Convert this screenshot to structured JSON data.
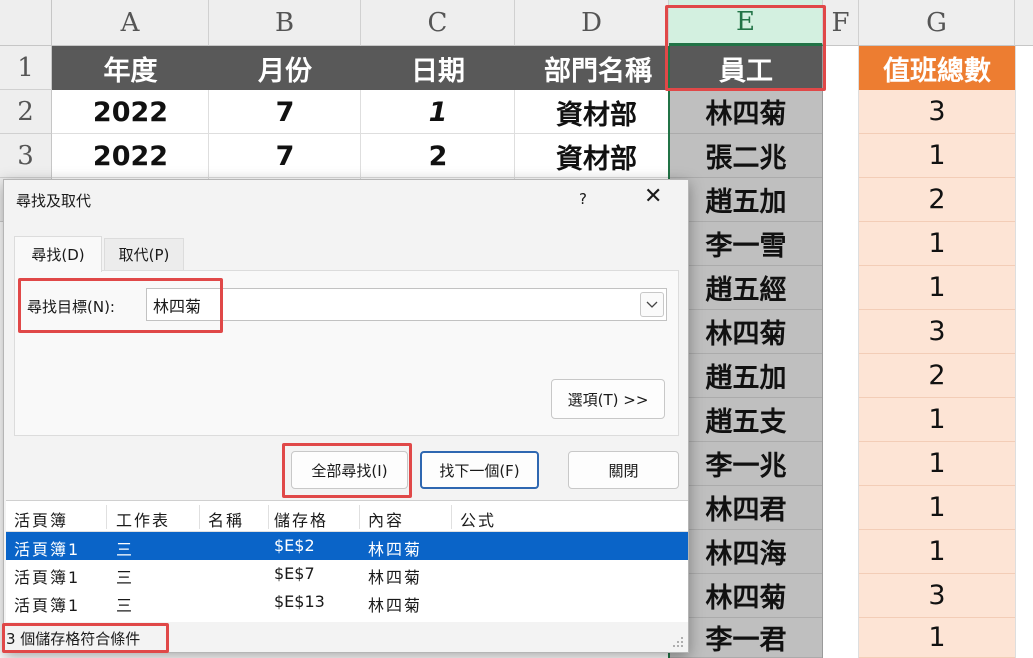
{
  "spreadsheet": {
    "column_headers": [
      "A",
      "B",
      "C",
      "D",
      "E",
      "F",
      "G"
    ],
    "row_headers": [
      "1",
      "2",
      "3"
    ],
    "header_row": {
      "year": "年度",
      "month": "月份",
      "day": "日期",
      "dept": "部門名稱",
      "employee": "員工",
      "duty_total": "值班總數"
    },
    "rows_abcd": [
      {
        "year": "2022",
        "month": "7",
        "day": "1",
        "dept": "資材部"
      },
      {
        "year": "2022",
        "month": "7",
        "day": "2",
        "dept": "資材部"
      }
    ],
    "employees": [
      "林四菊",
      "張二兆",
      "趙五加",
      "李一雪",
      "趙五經",
      "林四菊",
      "趙五加",
      "趙五支",
      "李一兆",
      "林四君",
      "林四海",
      "林四菊",
      "李一君"
    ],
    "duty_totals": [
      "3",
      "1",
      "2",
      "1",
      "1",
      "3",
      "2",
      "1",
      "1",
      "1",
      "1",
      "3",
      "1"
    ]
  },
  "dialog": {
    "title": "尋找及取代",
    "help": "?",
    "close": "✕",
    "tabs": {
      "find": "尋找(D)",
      "replace": "取代(P)"
    },
    "find_label": "尋找目標(N):",
    "find_value": "林四菊",
    "options_button": "選項(T) >>",
    "find_all_button": "全部尋找(I)",
    "find_next_button": "找下一個(F)",
    "close_button": "關閉",
    "results_headers": {
      "book": "活頁簿",
      "sheet": "工作表",
      "name": "名稱",
      "cell": "儲存格",
      "value": "內容",
      "formula": "公式"
    },
    "results": [
      {
        "book": "活頁簿1",
        "sheet": "三",
        "cell": "$E$2",
        "value": "林四菊"
      },
      {
        "book": "活頁簿1",
        "sheet": "三",
        "cell": "$E$7",
        "value": "林四菊"
      },
      {
        "book": "活頁簿1",
        "sheet": "三",
        "cell": "$E$13",
        "value": "林四菊"
      }
    ],
    "status": "3 個儲存格符合條件"
  },
  "colors": {
    "accent": "#ed7d31",
    "header_fill": "#595959",
    "selection": "#0a64c8",
    "highlight_box": "#e04848"
  }
}
